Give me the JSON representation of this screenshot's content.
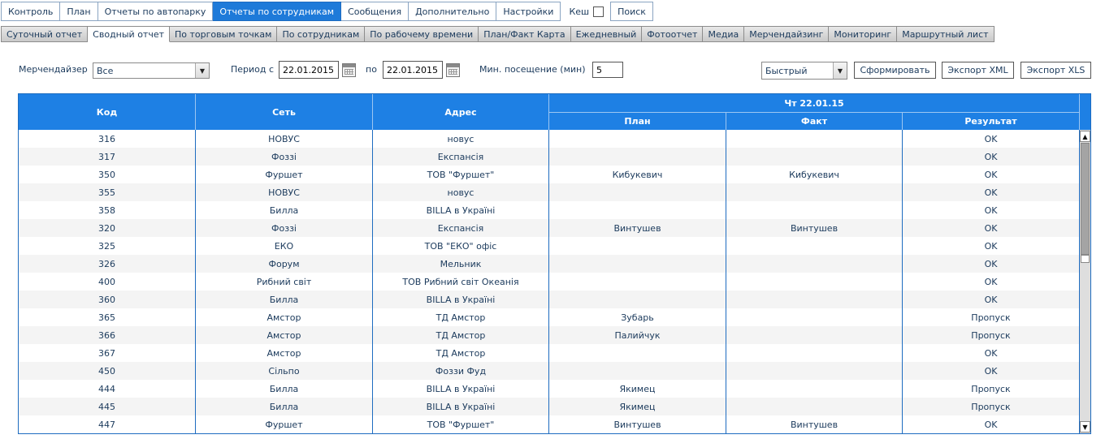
{
  "topnav": {
    "tabs": [
      "Контроль",
      "План",
      "Отчеты по автопарку",
      "Отчеты по сотрудникам",
      "Сообщения",
      "Дополнительно",
      "Настройки"
    ],
    "active_index": 3,
    "cache_label": "Кеш",
    "search_label": "Поиск"
  },
  "subnav": {
    "tabs": [
      "Суточный отчет",
      "Сводный отчет",
      "По торговым точкам",
      "По сотрудникам",
      "По рабочему времени",
      "План/Факт Карта",
      "Ежедневный",
      "Фотоотчет",
      "Медиа",
      "Мерчендайзинг",
      "Мониторинг",
      "Маршрутный лист"
    ],
    "active_index": 1
  },
  "filters": {
    "merch_label": "Мерчендайзер",
    "merch_value": "Все",
    "period_label": "Период с",
    "date_from": "22.01.2015",
    "to_label": "по",
    "date_to": "22.01.2015",
    "min_visit_label": "Мин. посещение (мин)",
    "min_visit_value": "5",
    "mode_value": "Быстрый",
    "generate_label": "Сформировать",
    "export_xml_label": "Экспорт XML",
    "export_xls_label": "Экспорт XLS"
  },
  "table": {
    "headers": {
      "code": "Код",
      "network": "Сеть",
      "address": "Адрес",
      "day": "Чт 22.01.15",
      "plan": "План",
      "fact": "Факт",
      "result": "Результат"
    },
    "rows": [
      [
        "316",
        "НОВУС",
        "новус",
        "",
        "",
        "OK"
      ],
      [
        "317",
        "Фоззі",
        "Експансія",
        "",
        "",
        "OK"
      ],
      [
        "350",
        "Фуршет",
        "ТОВ \"Фуршет\"",
        "Кибукевич",
        "Кибукевич",
        "OK"
      ],
      [
        "355",
        "НОВУС",
        "новус",
        "",
        "",
        "OK"
      ],
      [
        "358",
        "Билла",
        "BILLA в Україні",
        "",
        "",
        "OK"
      ],
      [
        "320",
        "Фоззі",
        "Експансія",
        "Винтушев",
        "Винтушев",
        "OK"
      ],
      [
        "325",
        "ЕКО",
        "ТОВ \"ЕКО\" офіс",
        "",
        "",
        "OK"
      ],
      [
        "326",
        "Форум",
        "Мельник",
        "",
        "",
        "OK"
      ],
      [
        "400",
        "Рибний світ",
        "ТОВ Рибний світ Океанія",
        "",
        "",
        "OK"
      ],
      [
        "360",
        "Билла",
        "BILLA в Україні",
        "",
        "",
        "OK"
      ],
      [
        "365",
        "Амстор",
        "ТД Амстор",
        "Зубарь",
        "",
        "Пропуск"
      ],
      [
        "366",
        "Амстор",
        "ТД Амстор",
        "Палийчук",
        "",
        "Пропуск"
      ],
      [
        "367",
        "Амстор",
        "ТД Амстор",
        "",
        "",
        "OK"
      ],
      [
        "450",
        "Сільпо",
        "Фоззи Фуд",
        "",
        "",
        "OK"
      ],
      [
        "444",
        "Билла",
        "BILLA в Україні",
        "Якимец",
        "",
        "Пропуск"
      ],
      [
        "445",
        "Билла",
        "BILLA в Україні",
        "Якимец",
        "",
        "Пропуск"
      ],
      [
        "447",
        "Фуршет",
        "ТОВ \"Фуршет\"",
        "Винтушев",
        "Винтушев",
        "OK"
      ]
    ]
  },
  "colors": {
    "accent": "#1e80e4",
    "text": "#1b3a5c"
  }
}
